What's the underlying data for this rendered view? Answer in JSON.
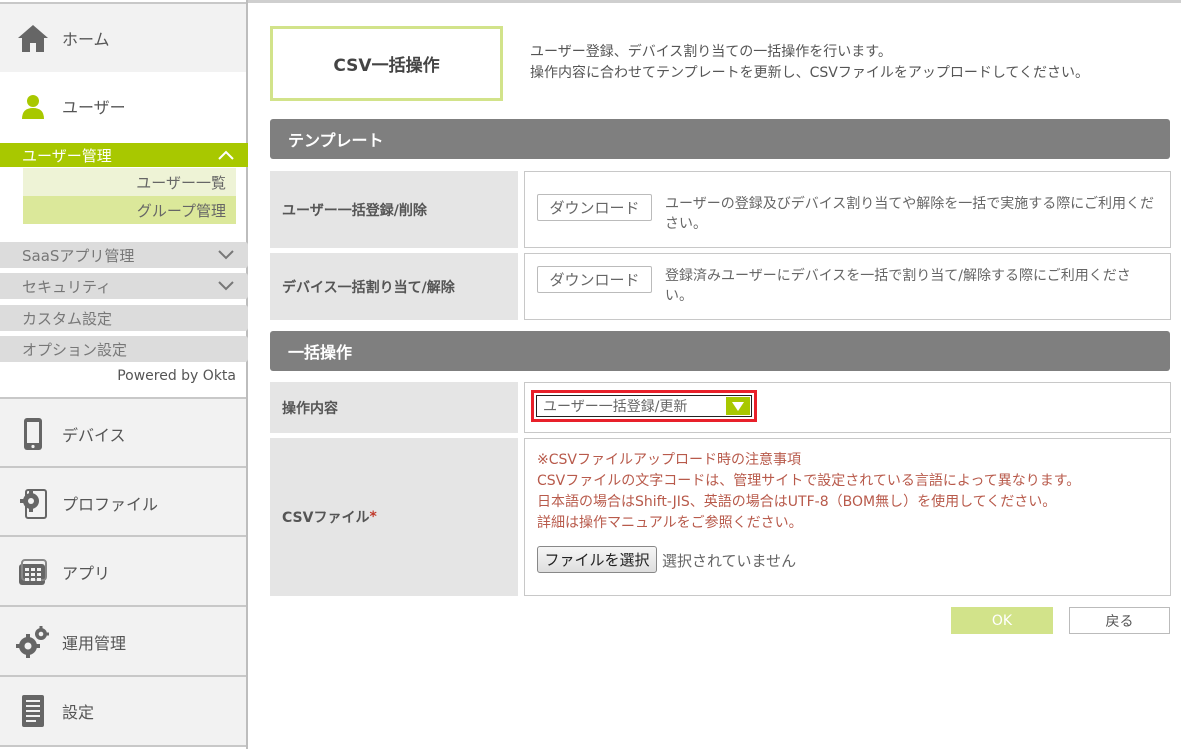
{
  "sidebar": {
    "home": "ホーム",
    "user": "ユーザー",
    "user_mgmt": "ユーザー管理",
    "user_list": "ユーザー一覧",
    "group_mgmt": "グループ管理",
    "saas_mgmt": "SaaSアプリ管理",
    "security": "セキュリティ",
    "custom": "カスタム設定",
    "options": "オプション設定",
    "powered": "Powered by Okta",
    "device": "デバイス",
    "profile": "プロファイル",
    "apps": "アプリ",
    "operations": "運用管理",
    "settings": "設定"
  },
  "colors": {
    "accent": "#a8c800",
    "section": "#7f7f7f",
    "highlight": "#e8202a"
  },
  "page": {
    "title": "CSV一括操作",
    "desc_line1": "ユーザー登録、デバイス割り当ての一括操作を行います。",
    "desc_line2": "操作内容に合わせてテンプレートを更新し、CSVファイルをアップロードしてください。"
  },
  "template": {
    "header": "テンプレート",
    "rows": [
      {
        "label": "ユーザー一括登録/削除",
        "button": "ダウンロード",
        "text": "ユーザーの登録及びデバイス割り当てや解除を一括で実施する際にご利用ください。"
      },
      {
        "label": "デバイス一括割り当て/解除",
        "button": "ダウンロード",
        "text": "登録済みユーザーにデバイスを一括で割り当て/解除する際にご利用ください。"
      }
    ]
  },
  "bulk": {
    "header": "一括操作",
    "op_label": "操作内容",
    "op_value": "ユーザー一括登録/更新",
    "csv_label": "CSVファイル",
    "required_mark": "*",
    "notes": [
      "※CSVファイルアップロード時の注意事項",
      "CSVファイルの文字コードは、管理サイトで設定されている言語によって異なります。",
      "日本語の場合はShift-JIS、英語の場合はUTF-8（BOM無し）を使用してください。",
      "詳細は操作マニュアルをご参照ください。"
    ],
    "file_button": "ファイルを選択",
    "file_status": "選択されていません"
  },
  "actions": {
    "ok": "OK",
    "back": "戻る"
  }
}
